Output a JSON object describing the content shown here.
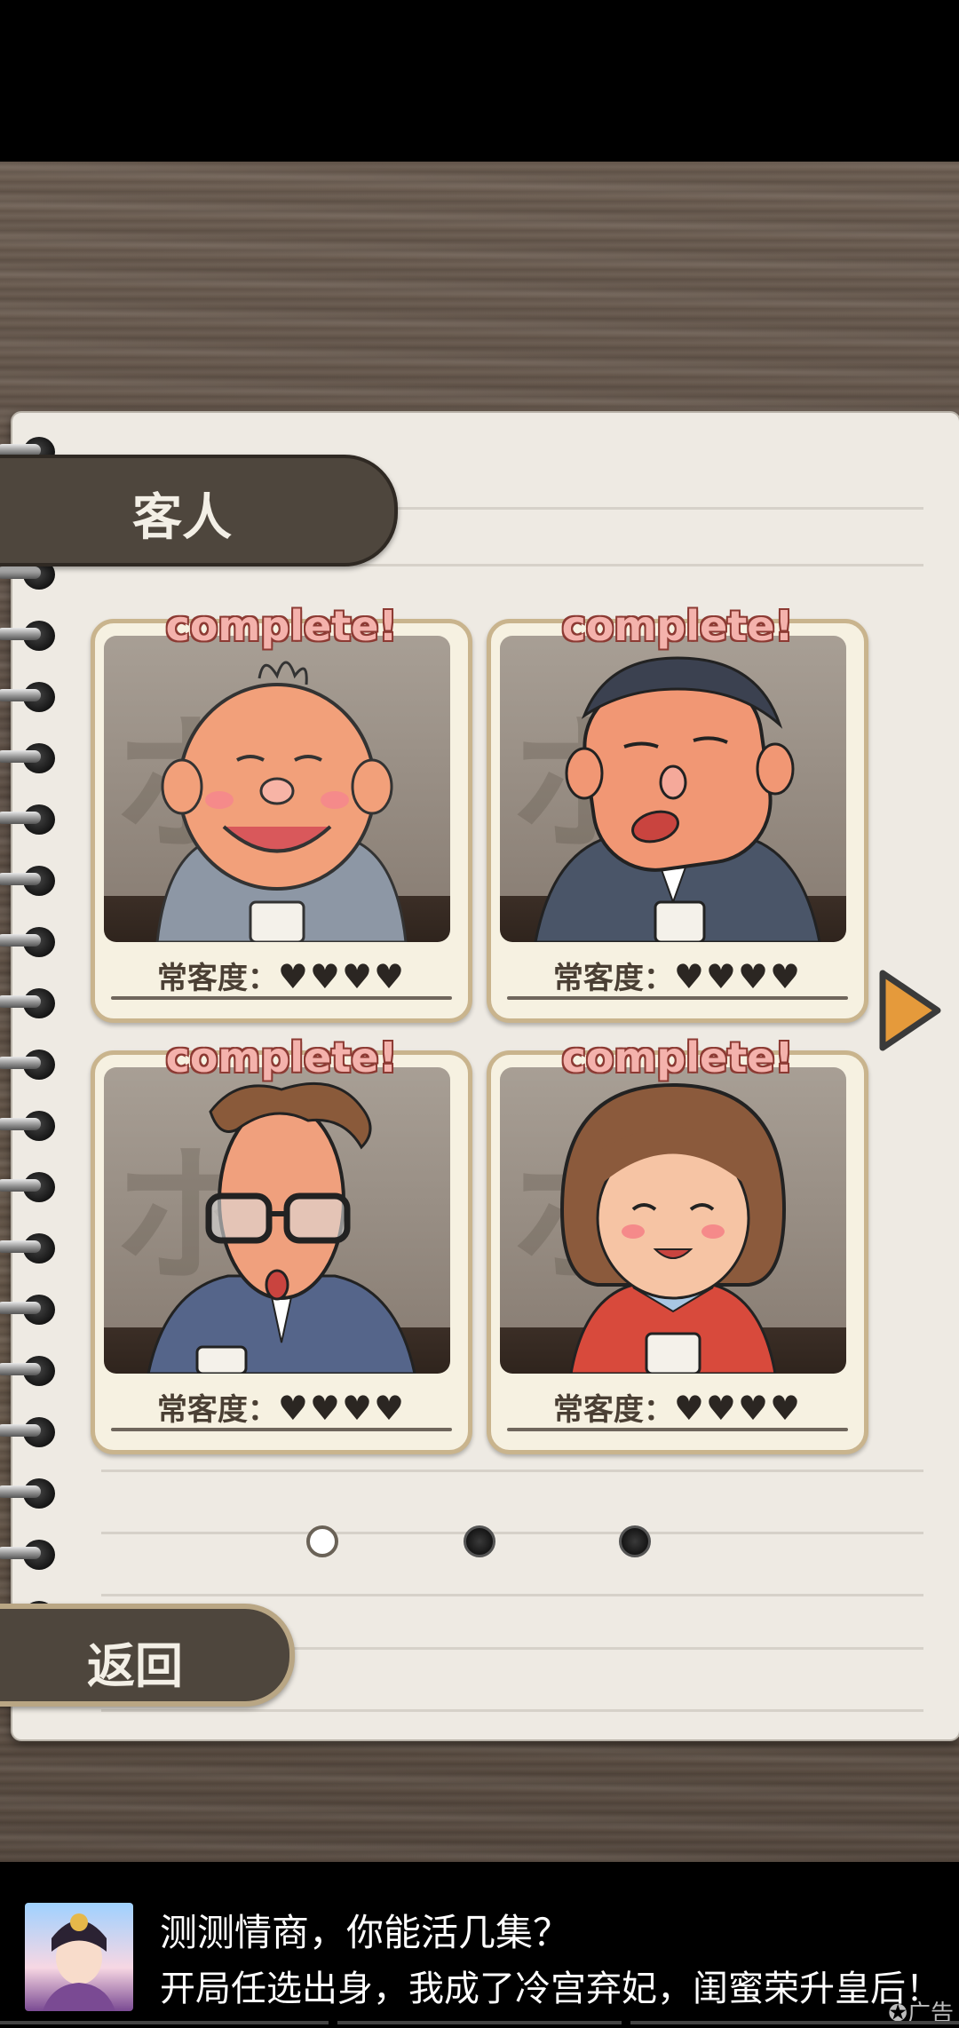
{
  "page": {
    "section_title": "客人",
    "back_label": "返回"
  },
  "cards": [
    {
      "status": "complete!",
      "stat_label": "常客度：",
      "hearts": "♥♥♥♥",
      "hearts_filled": 4,
      "hearts_total": 4,
      "kanji": "ホ"
    },
    {
      "status": "complete!",
      "stat_label": "常客度：",
      "hearts": "♥♥♥♥",
      "hearts_filled": 4,
      "hearts_total": 4,
      "kanji": "ホ"
    },
    {
      "status": "complete!",
      "stat_label": "常客度：",
      "hearts": "♥♥♥♥",
      "hearts_filled": 4,
      "hearts_total": 4,
      "kanji": "ホ"
    },
    {
      "status": "complete!",
      "stat_label": "常客度：",
      "hearts": "♥♥♥♥",
      "hearts_filled": 4,
      "hearts_total": 4,
      "kanji": "ホ"
    }
  ],
  "pagination": {
    "current": 1,
    "total": 3
  },
  "icons": {
    "next": "play-right-arrow-icon",
    "ad_mark": "ad-badge-icon"
  },
  "colors": {
    "tab_bg": "#4e463d",
    "card_border": "#c9b48d",
    "complete_text": "#f4b2ac",
    "arrow": "#e59a3b"
  },
  "ad": {
    "title": "测测情商，你能活几集？",
    "subtitle": "开局任选出身，我成了冷宫弃妃，闺蜜荣升皇后！",
    "label": "广告"
  }
}
